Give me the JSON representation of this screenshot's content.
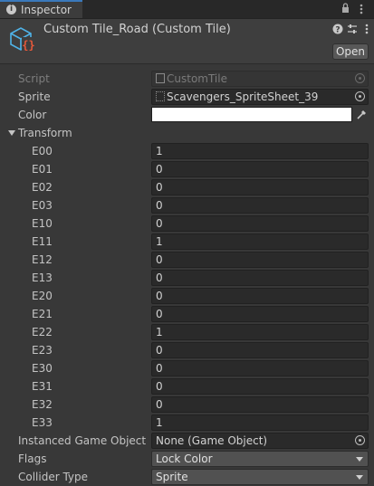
{
  "tab": {
    "label": "Inspector",
    "icon": "info-icon"
  },
  "tabbar_controls": {
    "lock_icon": "lock-icon",
    "menu_icon": "more-vertical-icon"
  },
  "header": {
    "title": "Custom Tile_Road (Custom Tile)",
    "help_icon": "help-icon",
    "settings_icon": "sliders-icon",
    "more_icon": "more-vertical-icon",
    "open_label": "Open"
  },
  "properties": {
    "script": {
      "label": "Script",
      "value": "CustomTile"
    },
    "sprite": {
      "label": "Sprite",
      "value": "Scavengers_SpriteSheet_39"
    },
    "color": {
      "label": "Color",
      "value": "#ffffff"
    },
    "transform": {
      "label": "Transform",
      "entries": [
        {
          "label": "E00",
          "value": "1"
        },
        {
          "label": "E01",
          "value": "0"
        },
        {
          "label": "E02",
          "value": "0"
        },
        {
          "label": "E03",
          "value": "0"
        },
        {
          "label": "E10",
          "value": "0"
        },
        {
          "label": "E11",
          "value": "1"
        },
        {
          "label": "E12",
          "value": "0"
        },
        {
          "label": "E13",
          "value": "0"
        },
        {
          "label": "E20",
          "value": "0"
        },
        {
          "label": "E21",
          "value": "0"
        },
        {
          "label": "E22",
          "value": "1"
        },
        {
          "label": "E23",
          "value": "0"
        },
        {
          "label": "E30",
          "value": "0"
        },
        {
          "label": "E31",
          "value": "0"
        },
        {
          "label": "E32",
          "value": "0"
        },
        {
          "label": "E33",
          "value": "1"
        }
      ]
    },
    "instanced_game_object": {
      "label": "Instanced Game Object",
      "value": "None (Game Object)"
    },
    "flags": {
      "label": "Flags",
      "value": "Lock Color"
    },
    "collider_type": {
      "label": "Collider Type",
      "value": "Sprite"
    }
  },
  "colors": {
    "accent": "#3a79bb",
    "background": "#383838",
    "field": "#2a2a2a"
  }
}
